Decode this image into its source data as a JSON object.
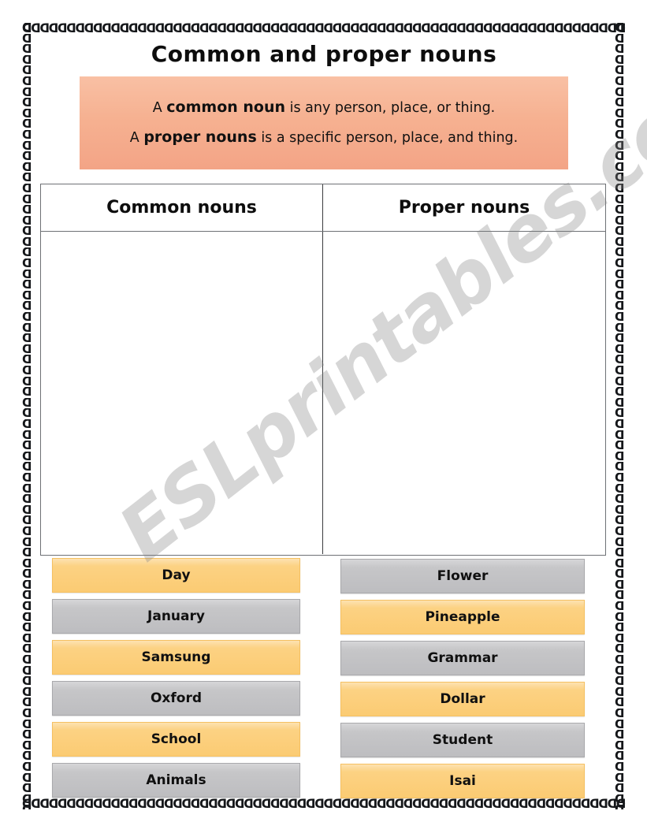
{
  "page": {
    "title": "Common and proper nouns",
    "watermark": "ESLprintables.com",
    "border_glyph": "ᗡ"
  },
  "definition_box": {
    "background_color": "#F6B191",
    "lines": [
      {
        "prefix": "A ",
        "keyword": "common noun",
        "suffix": " is any person, place, or thing."
      },
      {
        "prefix": "A ",
        "keyword": "proper nouns",
        "suffix": " is a specific person, place, and thing."
      }
    ]
  },
  "sort_table": {
    "columns": [
      {
        "header": "Common nouns"
      },
      {
        "header": "Proper nouns"
      }
    ]
  },
  "word_cards": {
    "colors": {
      "orange": "#FCD07F",
      "gray": "#C6C6C8"
    },
    "left_column": [
      {
        "label": "Day",
        "color": "orange"
      },
      {
        "label": "January",
        "color": "gray"
      },
      {
        "label": "Samsung",
        "color": "orange"
      },
      {
        "label": "Oxford",
        "color": "gray"
      },
      {
        "label": "School",
        "color": "orange"
      },
      {
        "label": "Animals",
        "color": "gray"
      }
    ],
    "right_column": [
      {
        "label": "Flower",
        "color": "gray"
      },
      {
        "label": "Pineapple",
        "color": "orange"
      },
      {
        "label": "Grammar",
        "color": "gray"
      },
      {
        "label": "Dollar",
        "color": "orange"
      },
      {
        "label": "Student",
        "color": "gray"
      },
      {
        "label": "Isai",
        "color": "orange"
      }
    ]
  }
}
